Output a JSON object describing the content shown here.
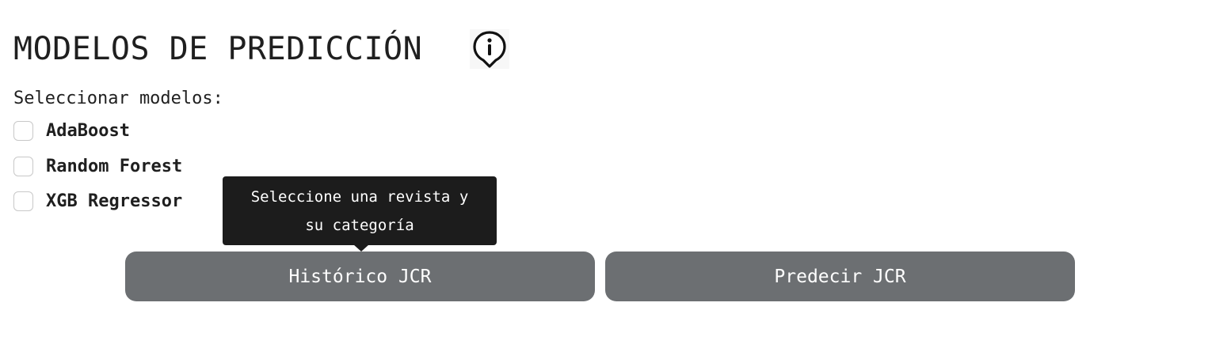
{
  "header": {
    "title": "MODELOS DE PREDICCIÓN",
    "info_icon": "info-icon"
  },
  "models": {
    "label": "Seleccionar modelos:",
    "options": [
      {
        "label": "AdaBoost",
        "checked": false
      },
      {
        "label": "Random Forest",
        "checked": false
      },
      {
        "label": "XGB Regressor",
        "checked": false
      }
    ]
  },
  "tooltip": {
    "line1": "Seleccione una revista y",
    "line2": "su categoría"
  },
  "buttons": {
    "historico": "Histórico JCR",
    "predecir": "Predecir JCR"
  },
  "colors": {
    "button_bg": "#6c6f72",
    "tooltip_bg": "#1c1c1c",
    "text": "#1f1f1f"
  }
}
